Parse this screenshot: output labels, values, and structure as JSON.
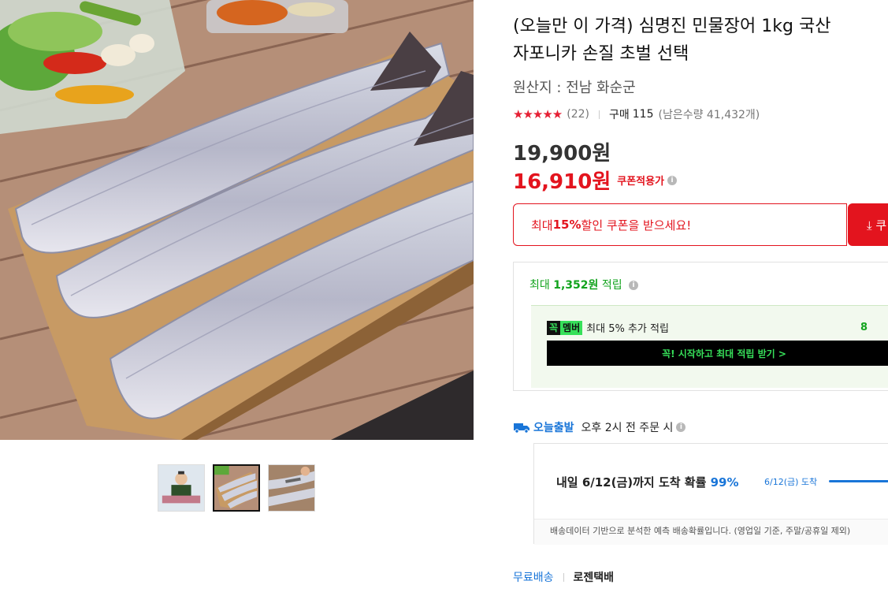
{
  "gallery": {
    "main_image_alt": "eel fillets on wooden board",
    "thumbnails": [
      {
        "name": "thumb-person-holding-eel",
        "active": false
      },
      {
        "name": "thumb-eel-board",
        "active": true
      },
      {
        "name": "thumb-eel-cutting",
        "active": false
      }
    ]
  },
  "product": {
    "title_line1": "(오늘만 이 가격) 심명진 민물장어 1kg 국산",
    "title_line2": "자포니카 손질 초벌 선택",
    "origin": "원산지 : 전남 화순군",
    "stars": "★★★★★",
    "review_count": "(22)",
    "buy_label": "구매",
    "buy_count": "115",
    "remaining": "(남은수량 41,432개)",
    "original_price": "19,900원",
    "sale_price": "16,910원",
    "coupon_price_label": "쿠폰적용가",
    "info_icon": "i"
  },
  "coupon": {
    "text_prefix": "최대 ",
    "text_bold": "15%",
    "text_suffix": " 할인 쿠폰을 받으세요!",
    "button_label": "⤓ 쿠"
  },
  "reward": {
    "prefix": "최대 ",
    "amount": "1,352원",
    "suffix": " 적립",
    "member_badge_a": "꼭",
    "member_badge_b": "멤버",
    "member_text": "최대 5% 추가 적립",
    "member_right": "8",
    "member_button": "꼭! 시작하고 최대 적립 받기 >"
  },
  "shipping": {
    "brand": "오늘출발",
    "desc": "오후 2시 전 주문 시",
    "main_prefix": "내일 6/12(금)까지 도착 확률 ",
    "main_pct": "99%",
    "side_label": "6/12(금) 도착",
    "probability": 0.99,
    "note": "배송데이터 기반으로 분석한 예측 배송확률입니다. (영업일 기준, 주말/공휴일 제외)",
    "free": "무료배송",
    "carrier": "로젠택배"
  },
  "colors": {
    "accent_red": "#e3141e",
    "accent_green": "#12a31d",
    "accent_blue": "#1975d8"
  }
}
